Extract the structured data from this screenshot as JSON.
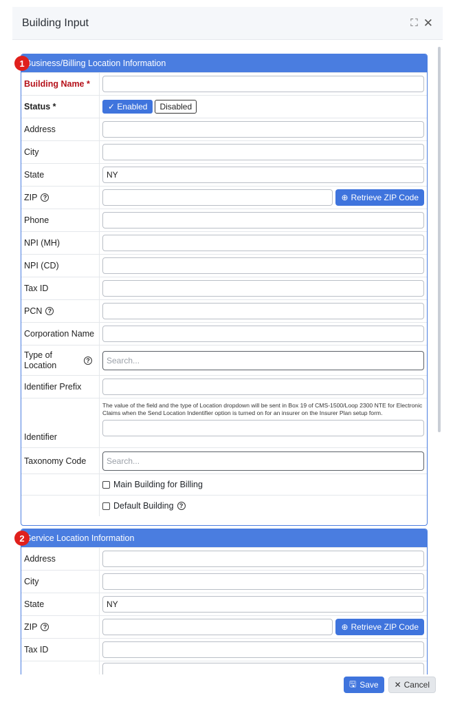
{
  "modal": {
    "title": "Building Input",
    "expand_icon": "expand-icon",
    "close_icon": "close-icon"
  },
  "billing": {
    "badge": "1",
    "header": "Business/Billing Location Information",
    "building_name_label": "Building Name *",
    "building_name_value": "",
    "status_label": "Status *",
    "status_enabled": "✓ Enabled",
    "status_disabled": "Disabled",
    "address_label": "Address",
    "address_value": "",
    "city_label": "City",
    "city_value": "",
    "state_label": "State",
    "state_value": "NY",
    "zip_label": "ZIP",
    "zip_value": "",
    "retrieve_zip": "Retrieve ZIP Code",
    "phone_label": "Phone",
    "phone_value": "",
    "npi_mh_label": "NPI (MH)",
    "npi_mh_value": "",
    "npi_cd_label": "NPI (CD)",
    "npi_cd_value": "",
    "tax_id_label": "Tax ID",
    "tax_id_value": "",
    "pcn_label": "PCN",
    "pcn_value": "",
    "corp_label": "Corporation Name",
    "corp_value": "",
    "type_label": "Type of Location",
    "type_placeholder": "Search...",
    "identifier_prefix_label": "Identifier Prefix",
    "identifier_prefix_value": "",
    "identifier_note": "The value of the field and the type of Location dropdown will be sent in Box 19 of CMS-1500/Loop 2300 NTE for Electronic Claims when the Send Location Indentifier option is turned on for an insurer on the Insurer Plan setup form.",
    "identifier_label": "Identifier",
    "identifier_value": "",
    "taxonomy_label": "Taxonomy Code",
    "taxonomy_placeholder": "Search...",
    "main_building_label": "Main Building for Billing",
    "default_building_label": "Default Building"
  },
  "service": {
    "badge": "2",
    "header": "Service Location Information",
    "address_label": "Address",
    "address_value": "",
    "city_label": "City",
    "city_value": "",
    "state_label": "State",
    "state_value": "NY",
    "zip_label": "ZIP",
    "zip_value": "",
    "retrieve_zip": "Retrieve ZIP Code",
    "tax_id_label": "Tax ID",
    "tax_id_value": ""
  },
  "footer": {
    "save": "Save",
    "cancel": "Cancel"
  },
  "colors": {
    "accent": "#4a7de0",
    "required": "#b5121b",
    "badge": "#e0201c"
  }
}
